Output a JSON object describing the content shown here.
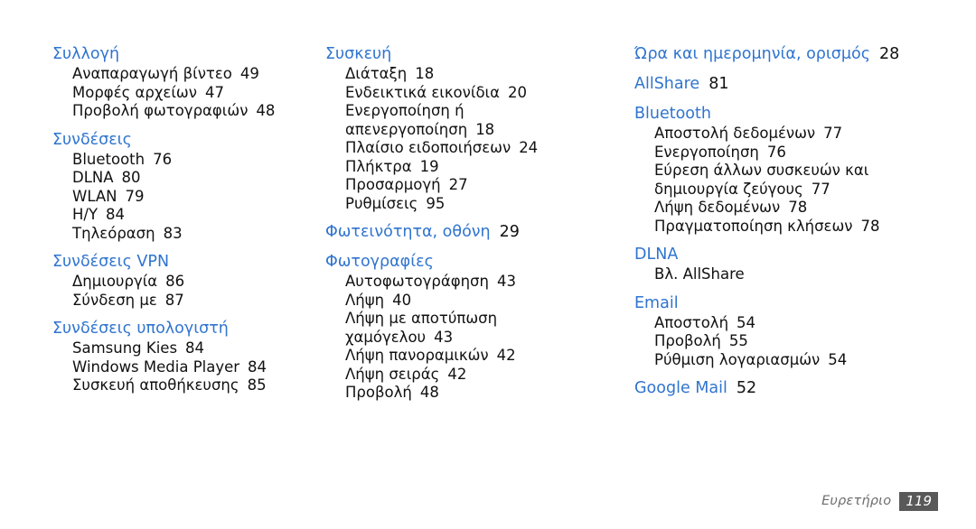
{
  "document": {
    "type": "index-page",
    "language": "el",
    "background_color": "#ffffff",
    "heading_color": "#2f74cf",
    "body_text_color": "#111111",
    "footer_label_color": "#6d6d6d",
    "footer_badge_color": "#595959"
  },
  "columns": [
    {
      "id": "column-1",
      "groups": [
        {
          "heading": "Συλλογή",
          "heading_page": "",
          "entries": [
            {
              "label": "Αναπαραγωγή βίντεο",
              "page": "49"
            },
            {
              "label": "Μορφές αρχείων",
              "page": "47"
            },
            {
              "label": "Προβολή φωτογραφιών",
              "page": "48"
            }
          ]
        },
        {
          "heading": "Συνδέσεις",
          "heading_page": "",
          "entries": [
            {
              "label": "Bluetooth",
              "page": "76"
            },
            {
              "label": "DLNA",
              "page": "80"
            },
            {
              "label": "WLAN",
              "page": "79"
            },
            {
              "label": "Η/Υ",
              "page": "84"
            },
            {
              "label": "Τηλεόραση",
              "page": "83"
            }
          ]
        },
        {
          "heading": "Συνδέσεις VPN",
          "heading_page": "",
          "entries": [
            {
              "label": "Δημιουργία",
              "page": "86"
            },
            {
              "label": "Σύνδεση με",
              "page": "87"
            }
          ]
        },
        {
          "heading": "Συνδέσεις υπολογιστή",
          "heading_page": "",
          "entries": [
            {
              "label": "Samsung Kies",
              "page": "84"
            },
            {
              "label": "Windows Media Player",
              "page": "84"
            },
            {
              "label": "Συσκευή αποθήκευσης",
              "page": "85"
            }
          ]
        }
      ]
    },
    {
      "id": "column-2",
      "groups": [
        {
          "heading": "Συσκευή",
          "heading_page": "",
          "entries": [
            {
              "label": "Διάταξη",
              "page": "18"
            },
            {
              "label": "Ενδεικτικά εικονίδια",
              "page": "20"
            },
            {
              "label": "Ενεργοποίηση ή",
              "label2": "απενεργοποίηση",
              "page": "18"
            },
            {
              "label": "Πλαίσιο ειδοποιήσεων",
              "page": "24"
            },
            {
              "label": "Πλήκτρα",
              "page": "19"
            },
            {
              "label": "Προσαρμογή",
              "page": "27"
            },
            {
              "label": "Ρυθμίσεις",
              "page": "95"
            }
          ]
        },
        {
          "heading": "Φωτεινότητα, οθόνη",
          "heading_page": "29",
          "entries": []
        },
        {
          "heading": "Φωτογραφίες",
          "heading_page": "",
          "entries": [
            {
              "label": "Αυτοφωτογράφηση",
              "page": "43"
            },
            {
              "label": "Λήψη",
              "page": "40"
            },
            {
              "label": "Λήψη με αποτύπωση",
              "label2": "χαμόγελου",
              "page": "43"
            },
            {
              "label": "Λήψη πανοραμικών",
              "page": "42"
            },
            {
              "label": "Λήψη σειράς",
              "page": "42"
            },
            {
              "label": "Προβολή",
              "page": "48"
            }
          ]
        }
      ]
    },
    {
      "id": "column-3",
      "groups": [
        {
          "heading": "Ώρα και ημερομηνία, ορισμός",
          "heading_page": "28",
          "entries": []
        },
        {
          "heading": "AllShare",
          "heading_page": "81",
          "entries": []
        },
        {
          "heading": "Bluetooth",
          "heading_page": "",
          "entries": [
            {
              "label": "Αποστολή δεδομένων",
              "page": "77"
            },
            {
              "label": "Ενεργοποίηση",
              "page": "76"
            },
            {
              "label": "Εύρεση άλλων συσκευών και",
              "label2": "δημιουργία ζεύγους",
              "page": "77"
            },
            {
              "label": "Λήψη δεδομένων",
              "page": "78"
            },
            {
              "label": "Πραγματοποίηση κλήσεων",
              "page": "78"
            }
          ]
        },
        {
          "heading": "DLNA",
          "heading_page": "",
          "entries": [
            {
              "label": "Βλ. AllShare",
              "page": ""
            }
          ]
        },
        {
          "heading": "Email",
          "heading_page": "",
          "entries": [
            {
              "label": "Αποστολή",
              "page": "54"
            },
            {
              "label": "Προβολή",
              "page": "55"
            },
            {
              "label": "Ρύθμιση λογαριασμών",
              "page": "54"
            }
          ]
        },
        {
          "heading": "Google Mail",
          "heading_page": "52",
          "entries": []
        }
      ]
    }
  ],
  "footer": {
    "label": "Ευρετήριο",
    "page_number": "119"
  }
}
